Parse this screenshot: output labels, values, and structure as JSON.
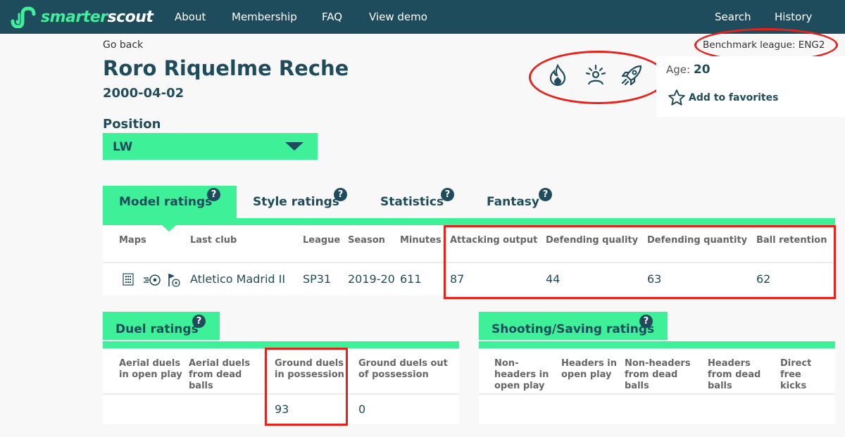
{
  "nav": {
    "logo": {
      "part1": "smarter",
      "part2": "scout"
    },
    "links": [
      "About",
      "Membership",
      "FAQ",
      "View demo"
    ],
    "right_links": [
      "Search",
      "History"
    ]
  },
  "player": {
    "go_back": "Go back",
    "name": "Roro Riquelme Reche",
    "dob": "2000-04-02",
    "position_label": "Position",
    "position_value": "LW",
    "benchmark": "Benchmark league: ENG2",
    "age_label": "Age:",
    "age_value": "20",
    "add_favorites": "Add to favorites",
    "badges": [
      "fire-icon",
      "star-player-icon",
      "rocket-icon"
    ]
  },
  "tabs": [
    {
      "label": "Model ratings",
      "active": true
    },
    {
      "label": "Style ratings",
      "active": false
    },
    {
      "label": "Statistics",
      "active": false
    },
    {
      "label": "Fantasy",
      "active": false
    }
  ],
  "model_table": {
    "headers": [
      "Maps",
      "Last club",
      "League",
      "Season",
      "Minutes",
      "Attacking output",
      "Defending quality",
      "Defending quantity",
      "Ball retention"
    ],
    "row": {
      "maps": [
        "heatmap-icon",
        "shot-map-icon",
        "set-piece-map-icon"
      ],
      "last_club": "Atletico Madrid II",
      "league": "SP31",
      "season": "2019-20",
      "minutes": "611",
      "attacking_output": "87",
      "defending_quality": "44",
      "defending_quantity": "63",
      "ball_retention": "62"
    }
  },
  "duel": {
    "title": "Duel ratings",
    "headers": [
      "Aerial duels in open play",
      "Aerial duels from dead balls",
      "Ground duels in possession",
      "Ground duels out of possession"
    ],
    "values": [
      "",
      "",
      "93",
      "0"
    ]
  },
  "shooting": {
    "title": "Shooting/Saving ratings",
    "headers": [
      "Non-headers in open play",
      "Headers in open play",
      "Non-headers from dead balls",
      "Headers from dead balls",
      "Direct free kicks"
    ],
    "values": [
      "",
      "",
      "",
      "",
      ""
    ]
  },
  "help_glyph": "?",
  "colors": {
    "navy": "#1f4c5d",
    "green": "#3ef097",
    "annotation_red": "#e8221b"
  }
}
